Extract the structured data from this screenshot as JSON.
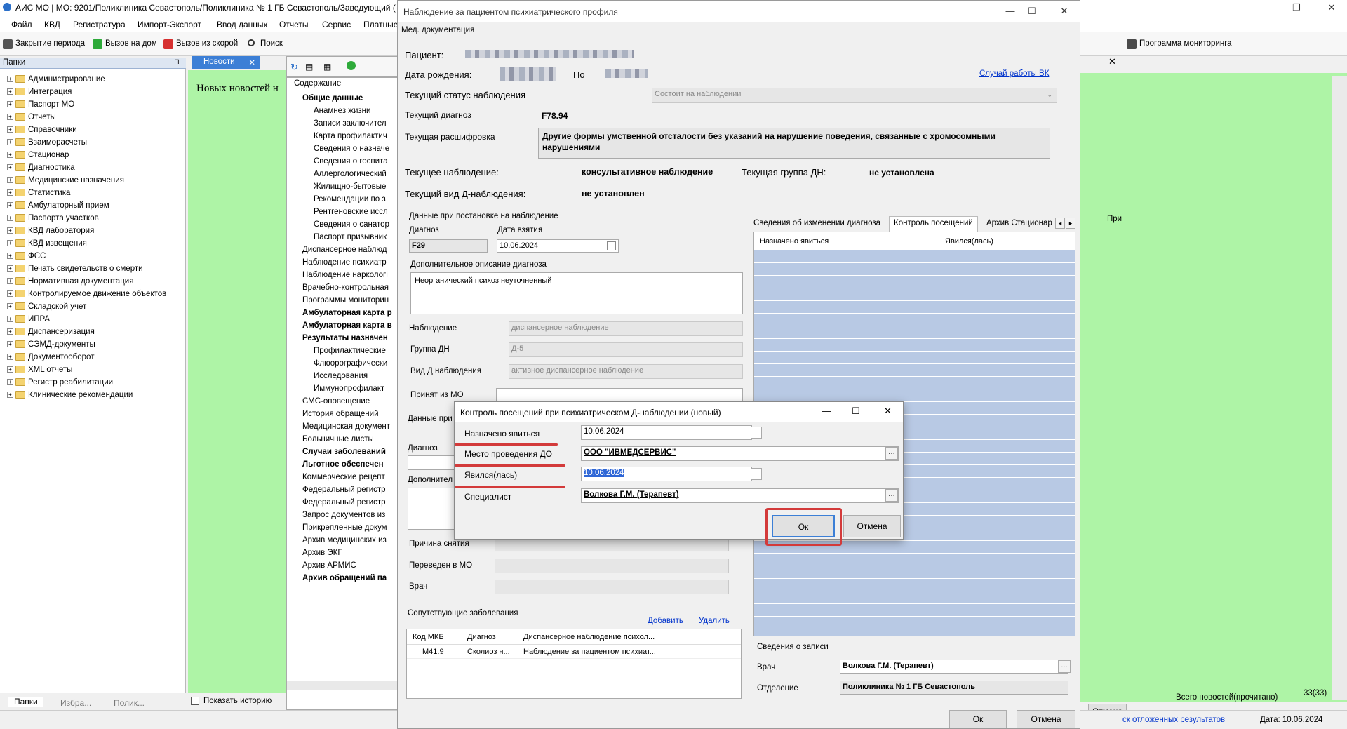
{
  "app": {
    "title": "АИС МО | МО: 9201/Поликлиника Севастополь/Поликлиника № 1 ГБ Севастополь/Заведующий ("
  },
  "menu": [
    "Файл",
    "КВД",
    "Регистратура",
    "Импорт-Экспорт",
    "Ввод данных",
    "Отчеты",
    "Сервис",
    "Платные"
  ],
  "toolbar": {
    "close_period": "Закрытие периода",
    "home_call": "Вызов на дом",
    "ambulance_call": "Вызов из скорой",
    "search": "Поиск",
    "monitoring": "Программа мониторинга"
  },
  "left_panel": {
    "title": "Папки",
    "items": [
      "Администрирование",
      "Интеграция",
      "Паспорт МО",
      "Отчеты",
      "Справочники",
      "Взаиморасчеты",
      "Стационар",
      "Диагностика",
      "Медицинские назначения",
      "Статистика",
      "Амбулаторный прием",
      "Паспорта участков",
      "КВД лаборатория",
      "КВД извещения",
      "ФСС",
      "Печать свидетельств о смерти",
      "Нормативная документация",
      "Контролируемое движение объектов",
      "Складской учет",
      "ИПРА",
      "Диспансеризация",
      "СЭМД-документы",
      "Документооборот",
      "XML отчеты",
      "Регистр реабилитации",
      "Клинические рекомендации"
    ],
    "tabs": [
      "Папки",
      "Избра...",
      "Полик..."
    ]
  },
  "news": {
    "tab": "Новости",
    "text": "Новых новостей н",
    "show_history": "Показать историю",
    "total": "Всего новостей(прочитано)",
    "count": "33(33)"
  },
  "status": {
    "deferred": "ск отложенных результатов",
    "date": "Дата: 10.06.2024"
  },
  "content_panel": {
    "header": "Содержание",
    "items": [
      {
        "t": "Общие данные",
        "b": true,
        "lvl": 0
      },
      {
        "t": "Анамнез жизни",
        "lvl": 1
      },
      {
        "t": "Записи заключител",
        "lvl": 1
      },
      {
        "t": "Карта профилактич",
        "lvl": 1
      },
      {
        "t": "Сведения о назначе",
        "lvl": 1
      },
      {
        "t": "Сведения о госпита",
        "lvl": 1
      },
      {
        "t": "Аллергологический",
        "lvl": 1
      },
      {
        "t": "Жилищно-бытовые",
        "lvl": 1
      },
      {
        "t": "Рекомендации по з",
        "lvl": 1
      },
      {
        "t": "Рентгеновские иссл",
        "lvl": 1
      },
      {
        "t": "Сведения о санатор",
        "lvl": 1
      },
      {
        "t": "Паспорт призывник",
        "lvl": 1
      },
      {
        "t": "Диспансерное наблюд",
        "lvl": 0
      },
      {
        "t": "Наблюдение психиатр",
        "lvl": 0
      },
      {
        "t": "Наблюдение наркологі",
        "lvl": 0
      },
      {
        "t": "Врачебно-контрольная",
        "lvl": 0
      },
      {
        "t": "Программы мониторин",
        "lvl": 0
      },
      {
        "t": "Амбулаторная карта р",
        "b": true,
        "lvl": 0
      },
      {
        "t": "Амбулаторная карта в",
        "b": true,
        "lvl": 0
      },
      {
        "t": "Результаты назначен",
        "b": true,
        "lvl": 0
      },
      {
        "t": "Профилактические",
        "lvl": 1
      },
      {
        "t": "Флюорографически",
        "lvl": 1
      },
      {
        "t": "Исследования",
        "lvl": 1
      },
      {
        "t": "Иммунопрофилакт",
        "lvl": 1
      },
      {
        "t": "СМС-оповещение",
        "lvl": 0
      },
      {
        "t": "История обращений",
        "lvl": 0
      },
      {
        "t": "Медицинская документ",
        "lvl": 0
      },
      {
        "t": "Больничные листы",
        "lvl": 0
      },
      {
        "t": "Случаи заболеваний",
        "b": true,
        "lvl": 0
      },
      {
        "t": "Льготное обеспечен",
        "b": true,
        "lvl": 0
      },
      {
        "t": "Коммерческие рецепт",
        "lvl": 0
      },
      {
        "t": "Федеральный регистр",
        "lvl": 0
      },
      {
        "t": "Федеральный регистр",
        "lvl": 0
      },
      {
        "t": "Запрос документов из",
        "lvl": 0
      },
      {
        "t": "Прикрепленные докум",
        "lvl": 0
      },
      {
        "t": "Архив медицинских из",
        "lvl": 0
      },
      {
        "t": "Архив ЭКГ",
        "lvl": 0
      },
      {
        "t": "Архив АРМИС",
        "lvl": 0
      },
      {
        "t": "Архив обращений па",
        "b": true,
        "lvl": 0
      }
    ]
  },
  "observation": {
    "title": "Наблюдение за пациентом психиатрического профиля",
    "menu": "Мед. документация",
    "patient_label": "Пациент:",
    "dob_label": "Дата рождения:",
    "by_label": "По",
    "vk_link": "Случай работы ВК",
    "status_label": "Текущий статус наблюдения",
    "status_value": "Состоит на наблюдении",
    "diag_label": "Текущий диагноз",
    "diag_value": "F78.94",
    "decode_label": "Текущая расшифровка",
    "decode_value": "Другие формы умственной отсталости без указаний на нарушение поведения, связанные с хромосомными нарушениями",
    "current_obs_label": "Текущее наблюдение:",
    "current_obs_value": "консультативное наблюдение",
    "group_label": "Текущая группа ДН:",
    "group_value": "не установлена",
    "kind_label": "Текущий вид Д-наблюдения:",
    "kind_value": "не установлен",
    "reg_section": "Данные при постановке на наблюдение",
    "reg_diag_label": "Диагноз",
    "reg_date_label": "Дата взятия",
    "reg_diag": "F29",
    "reg_date": "10.06.2024",
    "extra_desc_label": "Дополнительное описание диагноза",
    "extra_desc": "Неорганический психоз неуточненный",
    "obs_label": "Наблюдение",
    "obs_value": "диспансерное наблюдение",
    "dn_group_label": "Группа ДН",
    "dn_group_value": "Д-5",
    "dn_kind_label": "Вид Д наблюдения",
    "dn_kind_value": "активное диспансерное наблюдение",
    "accepted_label": "Принят из МО",
    "removal_section": "Данные при",
    "removal_diag_label": "Диагноз",
    "removal_extra_label": "Дополнител",
    "removal_reason_label": "Причина снятия",
    "transferred_label": "Переведен в МО",
    "doctor_label": "Врач",
    "comorb_title": "Сопутствующие заболевания",
    "add": "Добавить",
    "delete": "Удалить",
    "comorb_cols": [
      "Код МКБ",
      "Диагноз",
      "Диспансерное наблюдение психол..."
    ],
    "comorb_rows": [
      [
        "M41.9",
        "Сколиоз н...",
        "Наблюдение за пациентом психиат..."
      ]
    ],
    "tabs": [
      "Сведения об изменении диагноза",
      "Контроль посещений",
      "Архив Стационар"
    ],
    "visits_cols": [
      "Назначено явиться",
      "Явился(лась)"
    ],
    "record_section": "Сведения о записи",
    "rec_doctor_label": "Врач",
    "rec_doctor": "Волкова Г.М. (Терапевт)",
    "rec_dept_label": "Отделение",
    "rec_dept": "Поликлиника № 1 ГБ Севастополь",
    "ok": "Ок",
    "cancel": "Отмена",
    "right_cancel": "Отмена",
    "right_col": "При"
  },
  "dialog": {
    "title": "Контроль посещений при психиатрическом Д-наблюдении (новый)",
    "assigned_label": "Назначено явиться",
    "assigned_value": "10.06.2024",
    "place_label": "Место проведения ДО",
    "place_value": "ООО \"ИВМЕДСЕРВИС\"",
    "came_label": "Явился(лась)",
    "came_value": "10.06.2024",
    "specialist_label": "Специалист",
    "specialist_value": "Волкова Г.М. (Терапевт)",
    "ok": "Ок",
    "cancel": "Отмена"
  },
  "colors": {
    "green": "#aef4a6",
    "grid_blue": "#b8c9e4",
    "highlight_red": "#d33a3a",
    "link": "#0033cc"
  }
}
